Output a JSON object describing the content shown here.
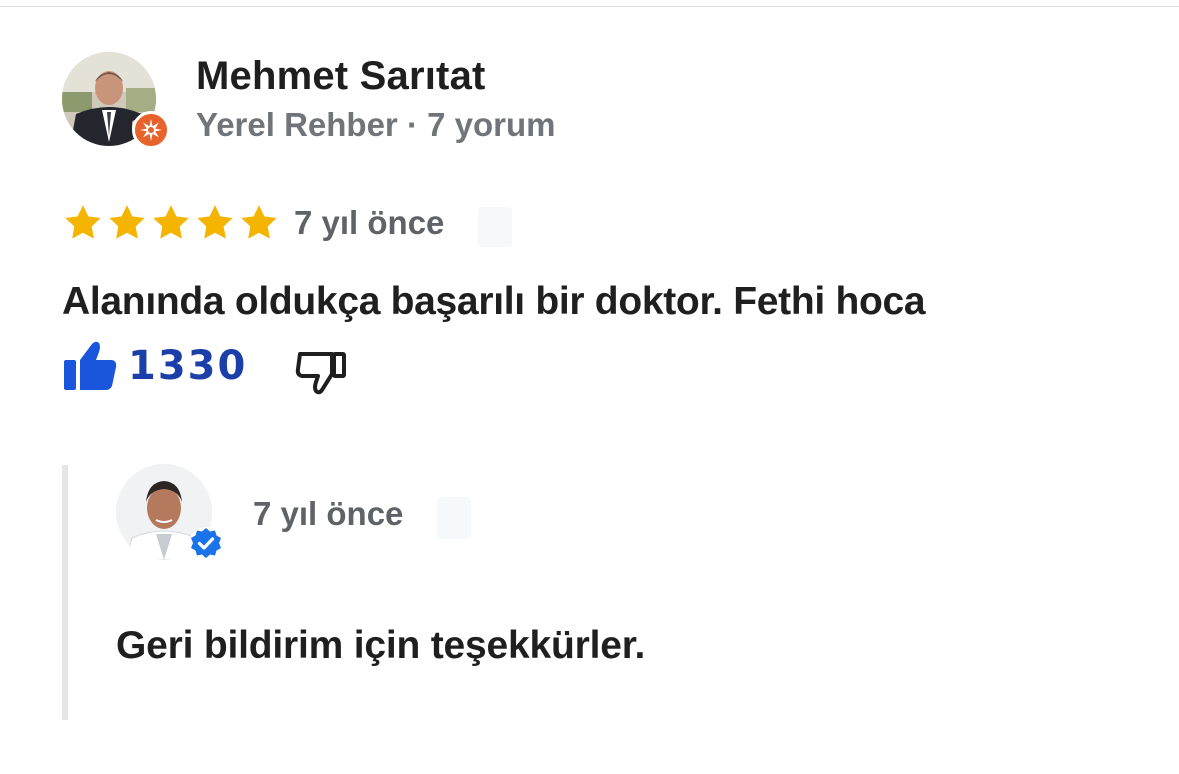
{
  "review": {
    "author": "Mehmet Sarıtat",
    "author_meta": "Yerel Rehber · 7 yorum",
    "rating": 5,
    "rating_max": 5,
    "time": "7 yıl önce",
    "text": "Alanında oldukça başarılı bir doktor. Fethi hoca",
    "likes": "1330"
  },
  "owner_reply": {
    "time": "7 yıl önce",
    "text": "Geri bildirim için teşekkürler."
  },
  "icons": {
    "local_guide_badge": "local-guide-badge-icon",
    "star": "star-icon",
    "like": "thumbs-up-icon",
    "dislike": "thumbs-down-icon",
    "verified": "verified-badge-icon"
  },
  "colors": {
    "star": "#F5B400",
    "like": "#1A3FA8",
    "guide_badge": "#E8622C",
    "verified": "#1A73E8",
    "meta_text": "#70757A"
  }
}
